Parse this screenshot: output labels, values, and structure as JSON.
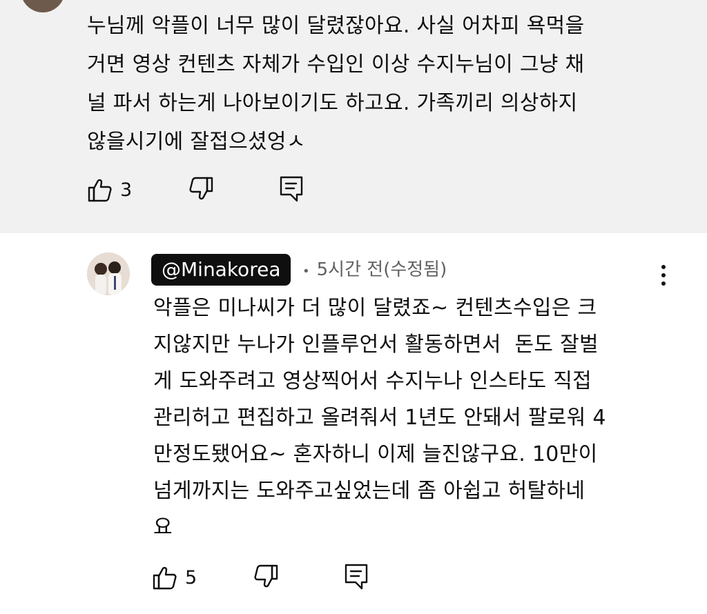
{
  "top_comment": {
    "text": "누님께 악플이 너무 많이 달렸잖아요. 사실 어차피 욕먹을\n거면 영상 컨텐츠 자체가 수입인 이상 수지누님이 그냥 채\n널 파서 하는게 나아보이기도 하고요. 가족끼리 의상하지\n않을시기에 잘접으셨엉ㅅ",
    "like_count": "3",
    "icons": {
      "like": "thumbs-up-icon",
      "dislike": "thumbs-down-icon",
      "reply": "reply-comment-icon",
      "menu": "more-vert-icon"
    },
    "colors": {
      "background": "#f1f1f1",
      "avatar": "#6e5a4c"
    }
  },
  "reply": {
    "handle": "@Minakorea",
    "time": "5시간 전(수정됨)",
    "text": "악플은 미나씨가 더 많이 달렸죠~ 컨텐츠수입은 크\n지않지만 누나가 인플루언서 활동하면서  돈도 잘벌\n게 도와주려고 영상찍어서 수지누나 인스타도 직접\n관리허고 편집하고 올려줘서 1년도 안돼서 팔로워 4\n만정도됐어요~ 혼자하니 이제 늘진않구요. 10만이\n넘게까지는 도와주고싶었는데 좀 아쉽고 허탈하네\n요",
    "like_count": "5",
    "icons": {
      "like": "thumbs-up-icon",
      "dislike": "thumbs-down-icon",
      "reply": "reply-comment-icon",
      "menu": "more-vert-icon"
    },
    "colors": {
      "handle_bg": "#0f0f0f",
      "handle_text": "#ffffff",
      "meta": "#606060"
    }
  }
}
